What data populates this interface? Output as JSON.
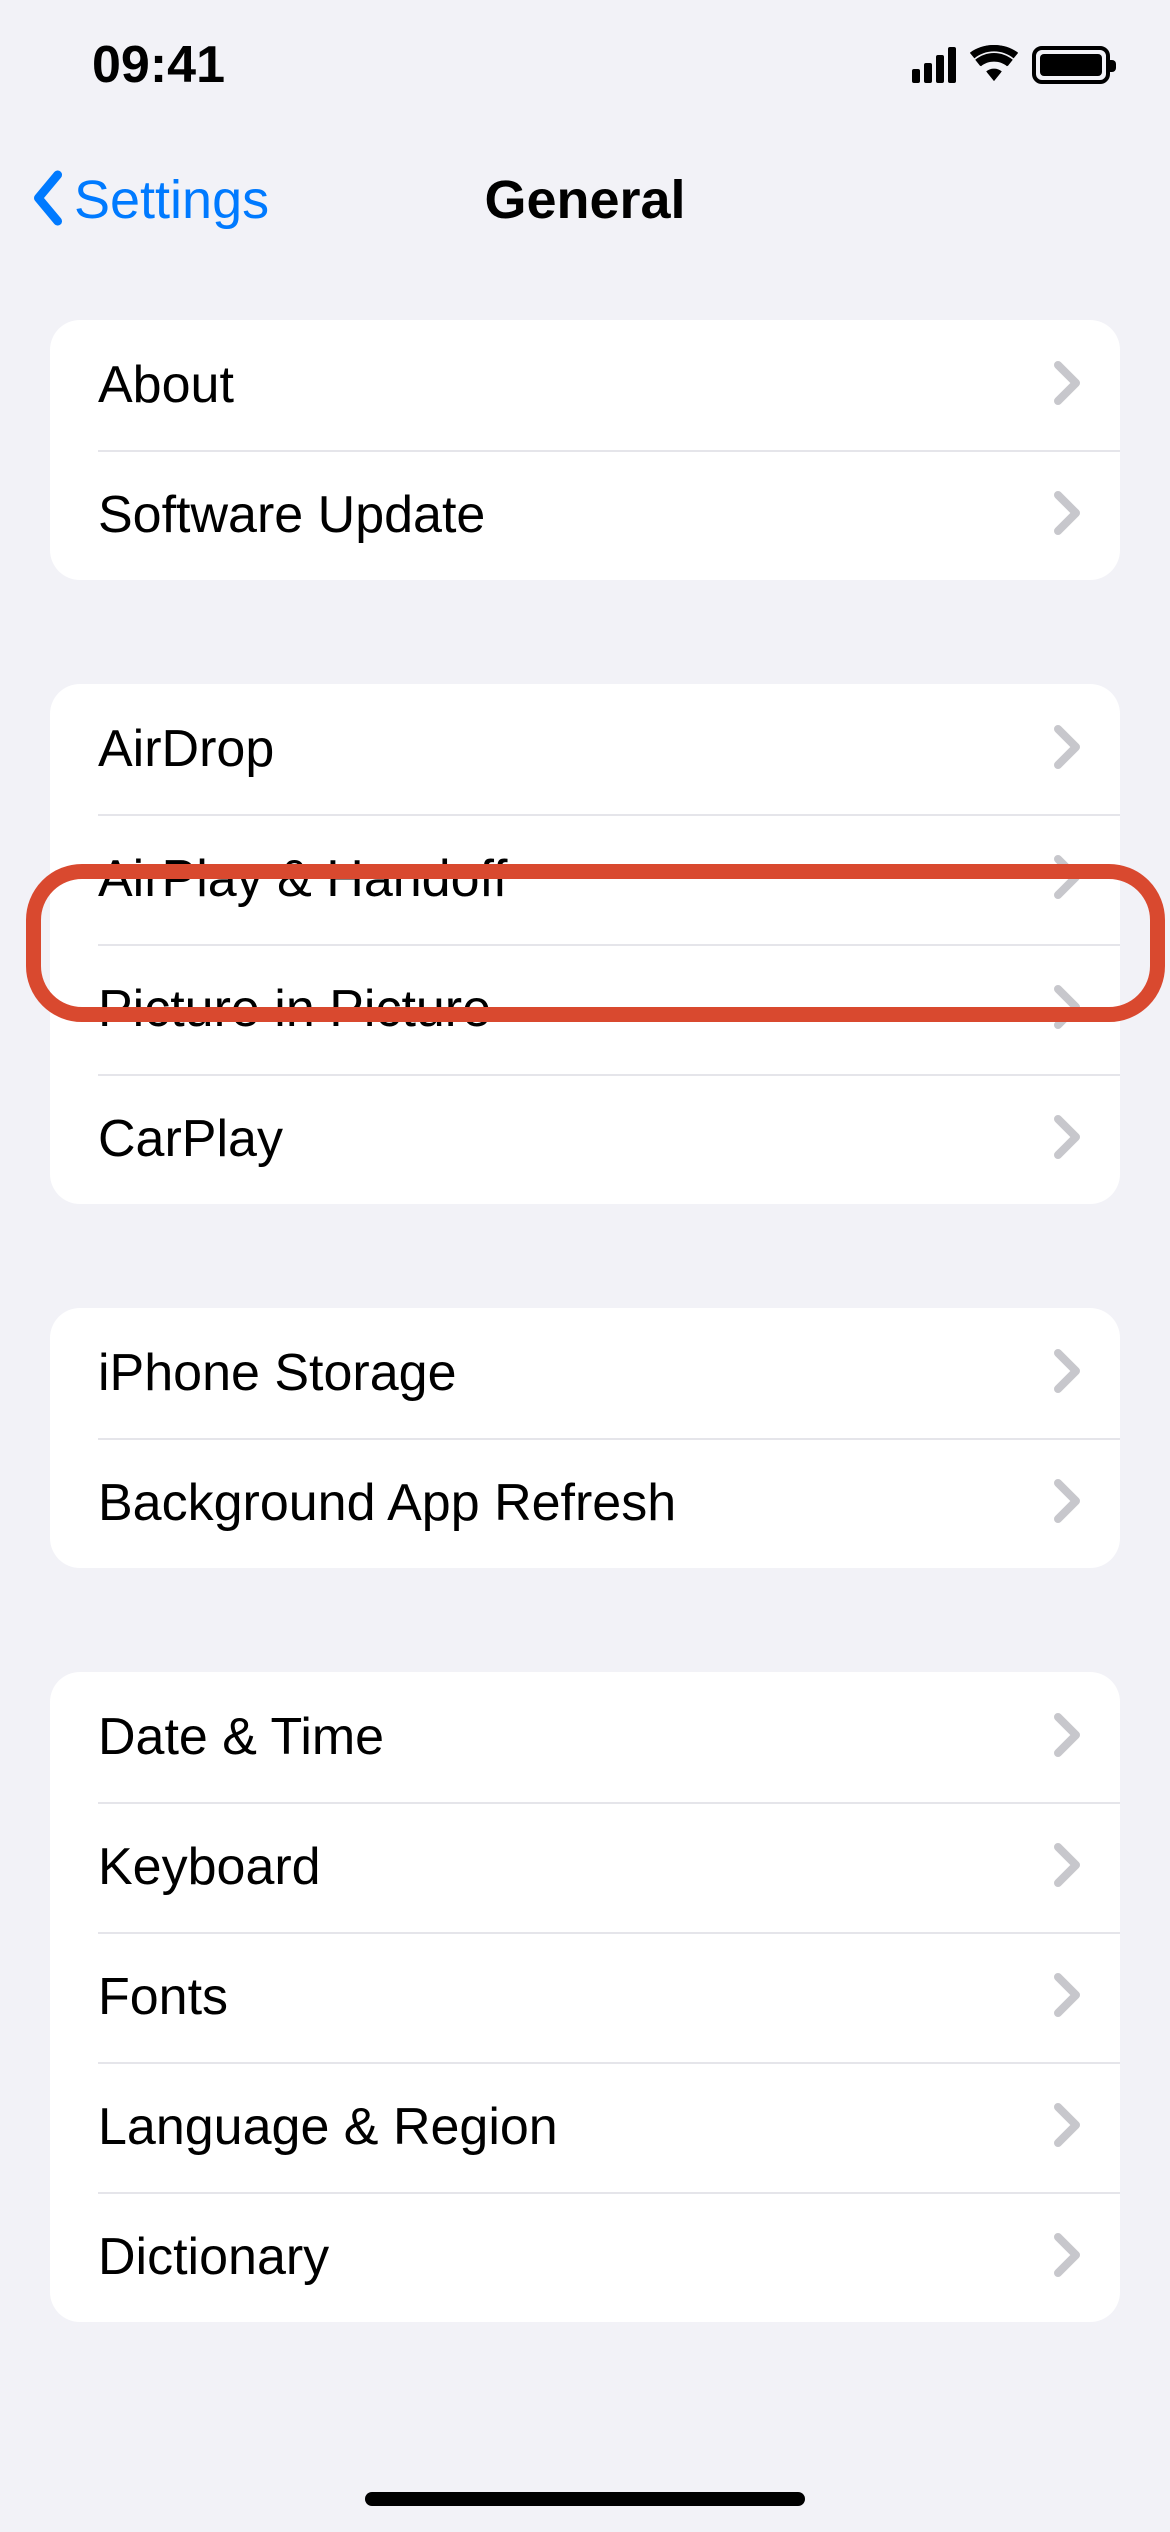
{
  "statusBar": {
    "time": "09:41"
  },
  "nav": {
    "backLabel": "Settings",
    "title": "General"
  },
  "groups": [
    {
      "rows": [
        {
          "id": "about",
          "label": "About"
        },
        {
          "id": "software-update",
          "label": "Software Update"
        }
      ]
    },
    {
      "rows": [
        {
          "id": "airdrop",
          "label": "AirDrop"
        },
        {
          "id": "airplay-handoff",
          "label": "AirPlay & Handoff",
          "highlighted": true
        },
        {
          "id": "picture-in-picture",
          "label": "Picture in Picture"
        },
        {
          "id": "carplay",
          "label": "CarPlay"
        }
      ]
    },
    {
      "rows": [
        {
          "id": "iphone-storage",
          "label": "iPhone Storage"
        },
        {
          "id": "background-app-refresh",
          "label": "Background App Refresh"
        }
      ]
    },
    {
      "rows": [
        {
          "id": "date-time",
          "label": "Date & Time"
        },
        {
          "id": "keyboard",
          "label": "Keyboard"
        },
        {
          "id": "fonts",
          "label": "Fonts"
        },
        {
          "id": "language-region",
          "label": "Language & Region"
        },
        {
          "id": "dictionary",
          "label": "Dictionary"
        }
      ]
    }
  ],
  "highlight": {
    "color": "#d9492f"
  }
}
